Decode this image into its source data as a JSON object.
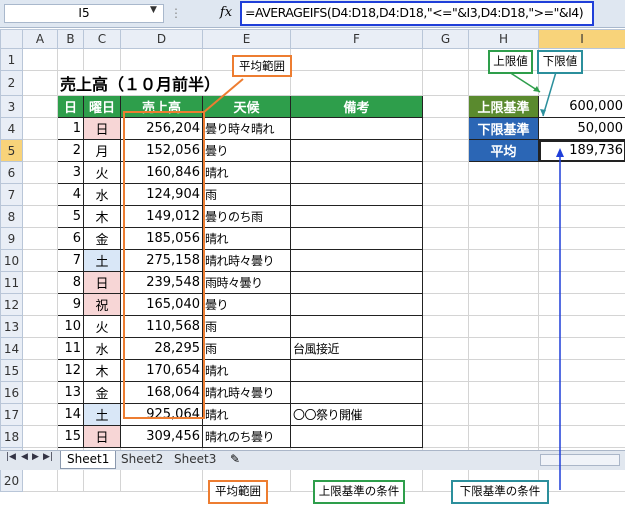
{
  "formula_bar": {
    "name_box": "I5",
    "fx_symbol": "fx",
    "formula": "=AVERAGEIFS(D4:D18,D4:D18,\"<=\"&I3,D4:D18,\">=\"&I4)"
  },
  "columns": [
    "A",
    "B",
    "C",
    "D",
    "E",
    "F",
    "G",
    "H",
    "I"
  ],
  "rows": [
    "1",
    "2",
    "3",
    "4",
    "5",
    "6",
    "7",
    "8",
    "9",
    "10",
    "11",
    "12",
    "13",
    "14",
    "15",
    "16",
    "17",
    "18",
    "19",
    "20"
  ],
  "selected_cell": {
    "column": "I",
    "row": "5"
  },
  "table": {
    "title": "売上高（１０月前半）",
    "headers": [
      "日",
      "曜日",
      "売上高",
      "天候",
      "備考"
    ],
    "rows": [
      {
        "day": "1",
        "weekday": "日",
        "sales": "256,204",
        "weather": "曇り時々晴れ",
        "note": "",
        "type": "holiday"
      },
      {
        "day": "2",
        "weekday": "月",
        "sales": "152,056",
        "weather": "曇り",
        "note": "",
        "type": "normal"
      },
      {
        "day": "3",
        "weekday": "火",
        "sales": "160,846",
        "weather": "晴れ",
        "note": "",
        "type": "normal"
      },
      {
        "day": "4",
        "weekday": "水",
        "sales": "124,904",
        "weather": "雨",
        "note": "",
        "type": "normal"
      },
      {
        "day": "5",
        "weekday": "木",
        "sales": "149,012",
        "weather": "曇りのち雨",
        "note": "",
        "type": "normal"
      },
      {
        "day": "6",
        "weekday": "金",
        "sales": "185,056",
        "weather": "晴れ",
        "note": "",
        "type": "normal"
      },
      {
        "day": "7",
        "weekday": "土",
        "sales": "275,158",
        "weather": "晴れ時々曇り",
        "note": "",
        "type": "saturday"
      },
      {
        "day": "8",
        "weekday": "日",
        "sales": "239,548",
        "weather": "雨時々曇り",
        "note": "",
        "type": "holiday"
      },
      {
        "day": "9",
        "weekday": "祝",
        "sales": "165,040",
        "weather": "曇り",
        "note": "",
        "type": "holiday"
      },
      {
        "day": "10",
        "weekday": "火",
        "sales": "110,568",
        "weather": "雨",
        "note": "",
        "type": "normal"
      },
      {
        "day": "11",
        "weekday": "水",
        "sales": "28,295",
        "weather": "雨",
        "note": "台風接近",
        "type": "normal"
      },
      {
        "day": "12",
        "weekday": "木",
        "sales": "170,654",
        "weather": "晴れ",
        "note": "",
        "type": "normal"
      },
      {
        "day": "13",
        "weekday": "金",
        "sales": "168,064",
        "weather": "晴れ時々曇り",
        "note": "",
        "type": "normal"
      },
      {
        "day": "14",
        "weekday": "土",
        "sales": "925,064",
        "weather": "晴れ",
        "note": "〇〇祭り開催",
        "type": "saturday"
      },
      {
        "day": "15",
        "weekday": "日",
        "sales": "309,456",
        "weather": "晴れのち曇り",
        "note": "",
        "type": "holiday"
      }
    ]
  },
  "criteria": {
    "upper_label": "上限基準",
    "upper_value": "600,000",
    "lower_label": "下限基準",
    "lower_value": "50,000",
    "average_label": "平均",
    "average_value": "189,736"
  },
  "callouts": {
    "avg_range_top": "平均範囲",
    "upper_top": "上限値",
    "lower_top": "下限値",
    "avg_range_bottom": "平均範囲",
    "upper_condition": "上限基準の条件",
    "lower_condition": "下限基準の条件"
  },
  "sheets": [
    "Sheet1",
    "Sheet2",
    "Sheet3"
  ],
  "colors": {
    "header_green": "#2e9e4b",
    "upper_green": "#5a8a2e",
    "average_blue": "#2b66b5",
    "callout_orange": "#ed7d31",
    "formula_border": "#1f3fd9"
  }
}
